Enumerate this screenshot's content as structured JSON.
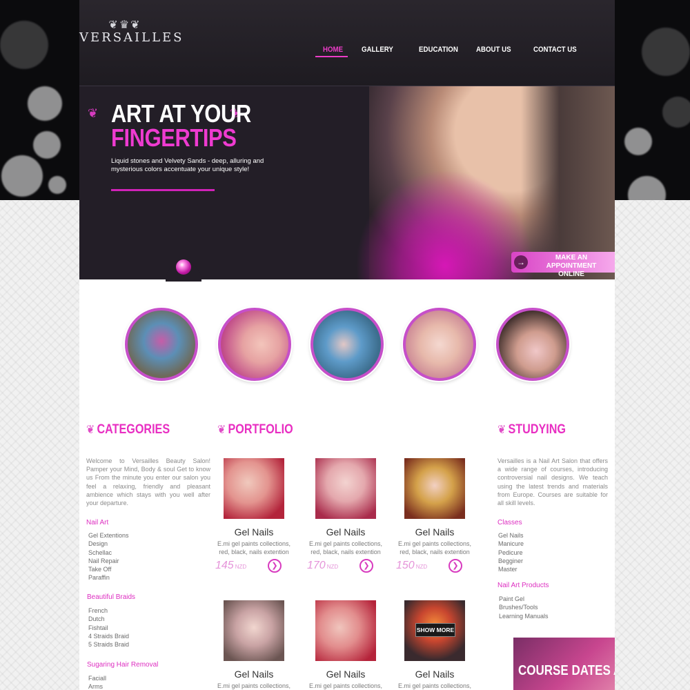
{
  "brand": {
    "name": "VERSAILLES",
    "crest": "❦♛❦"
  },
  "nav": [
    {
      "label": "HOME",
      "active": true
    },
    {
      "label": "GALLERY",
      "active": false
    },
    {
      "label": "EDUCATION",
      "active": false
    },
    {
      "label": "ABOUT US",
      "active": false
    },
    {
      "label": "CONTACT US",
      "active": false
    }
  ],
  "hero": {
    "title_line1": "ART AT YOUR",
    "title_line2": "FINGERTIPS",
    "tagline": "Liquid stones and Velvety Sands - deep, alluring and mysterious colors accentuate your unique style!",
    "appointment_line1": "MAKE AN APPOINTMENT",
    "appointment_line2": "ONLINE",
    "appointment_arrow": "→"
  },
  "colors": {
    "accent": "#e82ec2",
    "dark": "#231e27",
    "circle_border": "#c64fc9"
  },
  "circles": [
    "nail-art-photo-1",
    "nail-art-photo-2",
    "nail-art-photo-3",
    "nail-art-photo-4",
    "nail-art-photo-5"
  ],
  "categories": {
    "heading": "CATEGORIES",
    "intro": "Welcome to Versailles Beauty Salon! Pamper your Mind, Body & soul Get to know us From the minute you enter our salon you feel a relaxing, friendly and pleasant ambience which stays with you well after your departure.",
    "groups": [
      {
        "title": "Nail Art",
        "items": [
          "Gel Extentions",
          "Design",
          "Schellac",
          "Nail Repair",
          "Take Off",
          "Paraffin"
        ]
      },
      {
        "title": "Beautiful Braids",
        "items": [
          "French",
          "Dutch",
          "Fishtail",
          "4 Straids Braid",
          "5 Straids Braid"
        ]
      },
      {
        "title": "Sugaring Hair Removal",
        "items": [
          "Faciall",
          "Arms"
        ]
      }
    ]
  },
  "portfolio": {
    "heading": "PORTFOLIO",
    "show_more": "SHOW MORE",
    "products": [
      {
        "title": "Gel Nails",
        "desc": "E.mi gel paints collections, red, black, nails extention",
        "price": "145",
        "currency": "NZD"
      },
      {
        "title": "Gel Nails",
        "desc": "E.mi gel paints collections, red, black, nails extention",
        "price": "170",
        "currency": "NZD"
      },
      {
        "title": "Gel Nails",
        "desc": "E.mi gel paints collections, red, black, nails extention",
        "price": "150",
        "currency": "NZD"
      },
      {
        "title": "Gel Nails",
        "desc": "E.mi gel paints collections,"
      },
      {
        "title": "Gel Nails",
        "desc": "E.mi gel paints collections,"
      },
      {
        "title": "Gel Nails",
        "desc": "E.mi gel paints collections,"
      }
    ]
  },
  "studying": {
    "heading": "STUDYING",
    "intro": "Versailles is a Nail Art Salon that offers a wide range of courses, introducing controversial nail designs. We teach using the latest trends and materials from Europe. Courses are suitable for all skill levels.",
    "groups": [
      {
        "title": "Classes",
        "items": [
          "Gel Nails",
          "Manicure",
          "Pedicure",
          "Begginer",
          "Master"
        ]
      },
      {
        "title": "Nail Art Products",
        "items": [
          "Paint Gel",
          "Brushes/Tools",
          "Learning Manuals"
        ]
      }
    ],
    "course_banner": "COURSE DATES AND"
  }
}
